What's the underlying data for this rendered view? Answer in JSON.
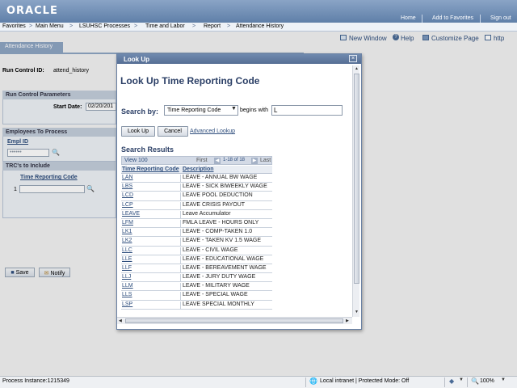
{
  "header": {
    "logo": "ORACLE",
    "links": [
      "Home",
      "Add to Favorites",
      "Sign out"
    ]
  },
  "nav": {
    "items": [
      "Favorites",
      "Main Menu",
      "LSUHSC Processes",
      "Time and Labor",
      "Report",
      "Attendance History"
    ],
    "separator": ">"
  },
  "toolbar": {
    "new_window": "New Window",
    "help": "Help",
    "customize_page": "Customize Page",
    "http": "http"
  },
  "page": {
    "tab": "Attendance History",
    "run_control_label": "Run Control ID:",
    "run_control_value": "attend_history",
    "params_header": "Run Control Parameters",
    "start_date_label": "Start Date:",
    "start_date_value": "02/20/201",
    "employees_header": "Employees To Process",
    "empl_id_label": "Empl ID",
    "empl_id_value": "••••••",
    "trcs_header": "TRC's to Include",
    "trc_col": "Time Reporting Code",
    "trc_row_num": "1",
    "save_btn": "Save",
    "notify_btn": "Notify"
  },
  "modal": {
    "title": "Look Up",
    "close": "×",
    "heading": "Look Up Time Reporting Code",
    "search_by_label": "Search by:",
    "search_by_value": "Time Reporting Code",
    "begins_with": "begins with",
    "search_value": "L",
    "lookup_btn": "Look Up",
    "cancel_btn": "Cancel",
    "advanced_lookup": "Advanced Lookup",
    "results_label": "Search Results",
    "grid": {
      "view": "View 100",
      "first": "First",
      "count": "1-18 of 18",
      "last": "Last",
      "col_code": "Time Reporting Code",
      "col_desc": "Description",
      "rows": [
        {
          "code": "LAN",
          "desc": "LEAVE - ANNUAL BW WAGE"
        },
        {
          "code": "LBS",
          "desc": "LEAVE - SICK BIWEEKLY WAGE"
        },
        {
          "code": "LCD",
          "desc": "LEAVE POOL DEDUCTION"
        },
        {
          "code": "LCP",
          "desc": "LEAVE CRISIS PAYOUT"
        },
        {
          "code": "LEAVE",
          "desc": "Leave Accumulator"
        },
        {
          "code": "LFM",
          "desc": "FMLA LEAVE - HOURS ONLY"
        },
        {
          "code": "LK1",
          "desc": "LEAVE - COMP-TAKEN 1.0"
        },
        {
          "code": "LK2",
          "desc": "LEAVE - TAKEN KV 1.5 WAGE"
        },
        {
          "code": "LLC",
          "desc": "LEAVE - CIVIL WAGE"
        },
        {
          "code": "LLE",
          "desc": "LEAVE - EDUCATIONAL WAGE"
        },
        {
          "code": "LLF",
          "desc": "LEAVE - BEREAVEMENT WAGE"
        },
        {
          "code": "LLJ",
          "desc": "LEAVE - JURY DUTY WAGE"
        },
        {
          "code": "LLM",
          "desc": "LEAVE - MILITARY WAGE"
        },
        {
          "code": "LLS",
          "desc": "LEAVE - SPECIAL WAGE"
        },
        {
          "code": "LSP",
          "desc": "LEAVE SPECIAL MONTHLY"
        }
      ]
    }
  },
  "statusbar": {
    "process": "Process Instance:1215349",
    "zone": "Local intranet | Protected Mode: Off",
    "zoom": "100%"
  },
  "colors": {
    "header": "#5f7fa8",
    "accent": "#2b3f66",
    "link": "#2d4d7c"
  }
}
